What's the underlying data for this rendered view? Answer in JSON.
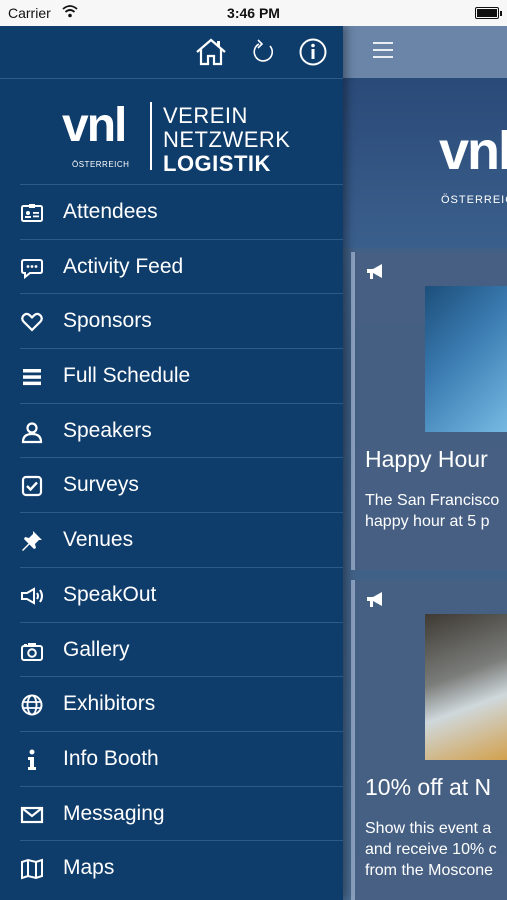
{
  "status_bar": {
    "carrier": "Carrier",
    "time": "3:46 PM"
  },
  "sidebar": {
    "logo": {
      "mark": "vnl",
      "mark_sub": "ÖSTERREICH",
      "line1": "VEREIN",
      "line2": "NETZWERK",
      "line3": "LOGISTIK"
    },
    "top_icons": [
      "home-icon",
      "refresh-icon",
      "info-icon"
    ],
    "items": [
      {
        "label": "Attendees",
        "icon": "id-card-icon"
      },
      {
        "label": "Activity Feed",
        "icon": "chat-bubble-icon"
      },
      {
        "label": "Sponsors",
        "icon": "heart-icon"
      },
      {
        "label": "Full Schedule",
        "icon": "list-icon"
      },
      {
        "label": "Speakers",
        "icon": "person-icon"
      },
      {
        "label": "Surveys",
        "icon": "checkbox-icon"
      },
      {
        "label": "Venues",
        "icon": "pin-icon"
      },
      {
        "label": "SpeakOut",
        "icon": "megaphone-icon"
      },
      {
        "label": "Gallery",
        "icon": "camera-icon"
      },
      {
        "label": "Exhibitors",
        "icon": "globe-icon"
      },
      {
        "label": "Info Booth",
        "icon": "info-i-icon"
      },
      {
        "label": "Messaging",
        "icon": "envelope-icon"
      },
      {
        "label": "Maps",
        "icon": "map-icon"
      }
    ]
  },
  "main": {
    "logo_mark": "vnl",
    "logo_sub": "ÖSTERREICH",
    "cards": [
      {
        "title": "Happy Hour",
        "desc_line1": "The San Francisco",
        "desc_line2": "happy hour at 5 p"
      },
      {
        "title": "10% off at N",
        "desc_line1": "Show this event a",
        "desc_line2": "and receive 10% c",
        "desc_line3": "from the Moscone"
      }
    ]
  },
  "colors": {
    "sidebar_bg": "#0e3c6b",
    "divider": "#2e5a86",
    "text": "#ffffff"
  }
}
